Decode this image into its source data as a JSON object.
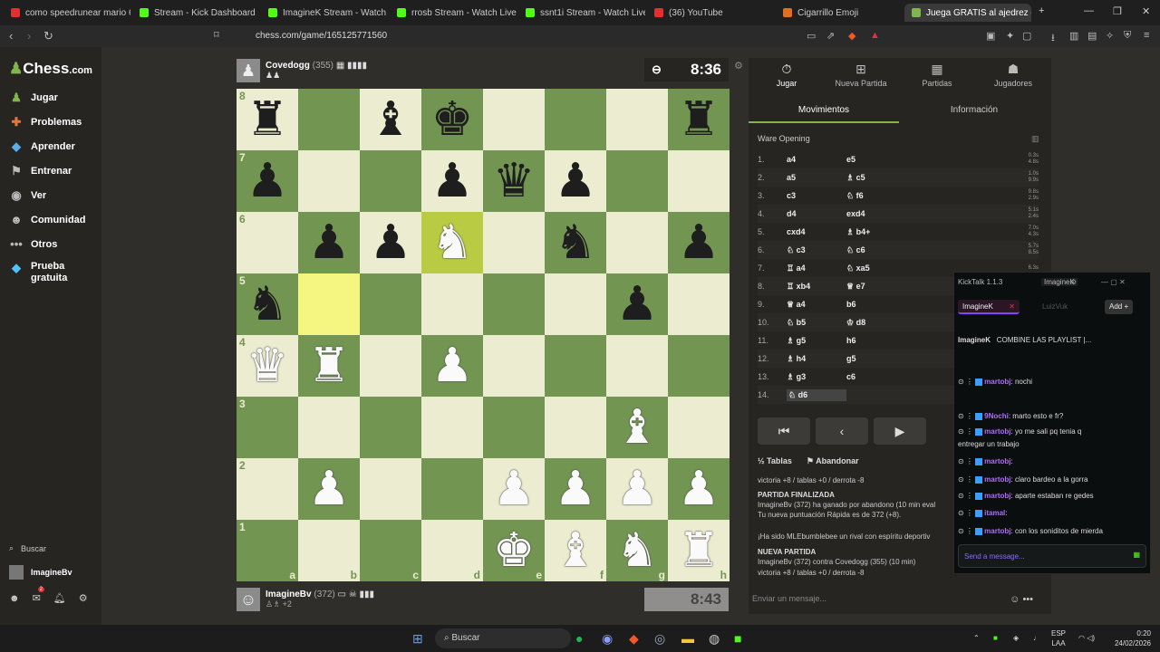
{
  "browser": {
    "tabs": [
      {
        "label": "como speedrunear mario 64 1(",
        "color": "#e03030"
      },
      {
        "label": "Stream - Kick Dashboard",
        "color": "#53fc18"
      },
      {
        "label": "ImagineK Stream - Watch Li",
        "color": "#53fc18"
      },
      {
        "label": "rrosb Stream - Watch Live",
        "color": "#53fc18"
      },
      {
        "label": "ssnt1i Stream - Watch Live",
        "color": "#53fc18"
      },
      {
        "label": "(36) YouTube",
        "color": "#e03030"
      },
      {
        "label": "Cigarrillo Emoji",
        "color": "#e07020"
      },
      {
        "label": "Juega GRATIS al ajedrez o",
        "color": "#81b64c"
      }
    ],
    "url": "chess.com/game/165125771560"
  },
  "sidebar": {
    "logo": "Chess",
    "logo_suffix": ".com",
    "items": [
      {
        "label": "Jugar",
        "icon": "play-icon",
        "color": "#81b64c"
      },
      {
        "label": "Problemas",
        "icon": "puzzle-icon",
        "color": "#e9773c"
      },
      {
        "label": "Aprender",
        "icon": "learn-icon",
        "color": "#5aaee8"
      },
      {
        "label": "Entrenar",
        "icon": "train-icon",
        "color": "#bbbbbb"
      },
      {
        "label": "Ver",
        "icon": "watch-icon",
        "color": "#bbbbbb"
      },
      {
        "label": "Comunidad",
        "icon": "community-icon",
        "color": "#bbbbbb"
      },
      {
        "label": "Otros",
        "icon": "more-icon",
        "color": "#bbbbbb"
      },
      {
        "label": "Prueba gratuita",
        "icon": "diamond-icon",
        "color": "#4fc3f7"
      }
    ],
    "search": "Buscar",
    "user": "ImagineBv",
    "notif_count": "2"
  },
  "game": {
    "top_player": {
      "name": "Covedogg",
      "rating": "(355)",
      "clock": "8:36"
    },
    "bottom_player": {
      "name": "ImagineBv",
      "rating": "(372)",
      "clock": "8:43",
      "material": "+2"
    },
    "board": [
      [
        "bR",
        "",
        "bB",
        "bK",
        "",
        "",
        "",
        "bR"
      ],
      [
        "bP",
        "",
        "",
        "bP",
        "bQ",
        "bP",
        "",
        ""
      ],
      [
        "",
        "bP",
        "bP",
        "wN",
        "",
        "bN",
        "",
        "bP"
      ],
      [
        "bN",
        "",
        "",
        "",
        "",
        "",
        "bP",
        ""
      ],
      [
        "wQ",
        "wR",
        "",
        "wP",
        "",
        "",
        "",
        ""
      ],
      [
        "",
        "",
        "",
        "",
        "",
        "",
        "wB",
        ""
      ],
      [
        "",
        "wP",
        "",
        "",
        "wP",
        "wP",
        "wP",
        "wP"
      ],
      [
        "",
        "",
        "",
        "",
        "wK",
        "wB",
        "wN",
        "wR"
      ]
    ],
    "highlights": [
      [
        2,
        3
      ],
      [
        3,
        1
      ]
    ],
    "files": [
      "a",
      "b",
      "c",
      "d",
      "e",
      "f",
      "g",
      "h"
    ],
    "ranks": [
      "8",
      "7",
      "6",
      "5",
      "4",
      "3",
      "2",
      "1"
    ]
  },
  "panel": {
    "tabs": [
      {
        "label": "Jugar",
        "icon": "stopwatch-icon"
      },
      {
        "label": "Nueva Partida",
        "icon": "plus-icon"
      },
      {
        "label": "Partidas",
        "icon": "board-icon"
      },
      {
        "label": "Jugadores",
        "icon": "players-icon"
      }
    ],
    "subtabs": [
      "Movimientos",
      "Información"
    ],
    "opening": "Ware Opening",
    "moves": [
      {
        "n": "1.",
        "w": "a4",
        "b": "e5",
        "t1": "0.3s",
        "t2": "4.8s"
      },
      {
        "n": "2.",
        "w": "a5",
        "b": "♗ c5",
        "t1": "1.0s",
        "t2": "9.9s"
      },
      {
        "n": "3.",
        "w": "c3",
        "b": "♘ f6",
        "t1": "9.8s",
        "t2": "2.9s"
      },
      {
        "n": "4.",
        "w": "d4",
        "b": "exd4",
        "t1": "5.1s",
        "t2": "2.4s"
      },
      {
        "n": "5.",
        "w": "cxd4",
        "b": "♗ b4+",
        "t1": "7.0s",
        "t2": "4.3s"
      },
      {
        "n": "6.",
        "w": "♘ c3",
        "b": "♘ c6",
        "t1": "5.7s",
        "t2": "8.5s"
      },
      {
        "n": "7.",
        "w": "♖ a4",
        "b": "♘ xa5",
        "t1": "6.3s",
        "t2": ""
      },
      {
        "n": "8.",
        "w": "♖ xb4",
        "b": "♕ e7",
        "t1": "",
        "t2": ""
      },
      {
        "n": "9.",
        "w": "♕ a4",
        "b": "b6",
        "t1": "",
        "t2": ""
      },
      {
        "n": "10.",
        "w": "♘ b5",
        "b": "♔ d8",
        "t1": "",
        "t2": ""
      },
      {
        "n": "11.",
        "w": "♗ g5",
        "b": "h6",
        "t1": "",
        "t2": ""
      },
      {
        "n": "12.",
        "w": "♗ h4",
        "b": "g5",
        "t1": "",
        "t2": ""
      },
      {
        "n": "13.",
        "w": "♗ g3",
        "b": "c6",
        "t1": "",
        "t2": ""
      },
      {
        "n": "14.",
        "w": "♘ d6",
        "b": "",
        "t1": "",
        "t2": ""
      }
    ],
    "draw": "Tablas",
    "resign": "Abandonar",
    "log": [
      {
        "text": "victoria +8 / tablas +0 / derrota -8",
        "h": false
      },
      {
        "text": "PARTIDA FINALIZADA",
        "h": true
      },
      {
        "text": "ImagineBv (372) ha ganado por abandono (10 min eval",
        "h": false
      },
      {
        "text": "Tu nueva puntuación Rápida es de 372 (+8).",
        "h": false
      },
      {
        "text": "¡Ha sido MLEbumblebee un rival con espíritu deportiv",
        "h": false
      },
      {
        "text": "NUEVA PARTIDA",
        "h": true
      },
      {
        "text": "ImagineBv (372) contra Covedogg (355) (10 min)",
        "h": false
      },
      {
        "text": "victoria +8 / tablas +0 / derrota -8",
        "h": false
      }
    ],
    "send_placeholder": "Enviar un mensaje..."
  },
  "kicktalk": {
    "title": "KickTalk 1.1.3",
    "header_user": "ImagineK",
    "tabs": [
      "ImagineK",
      "LuizVuk"
    ],
    "add": "Add",
    "channel": "ImagineK",
    "pinned": "COMBINE LAS PLAYLIST |...",
    "messages": [
      {
        "user": "martobj",
        "text": "nochi"
      },
      {
        "user": "9Nochi",
        "text": "marto esto e fr?"
      },
      {
        "user": "martobj",
        "text": "yo me sali pq tenia q"
      },
      {
        "user": "",
        "text": "entregar un trabajo"
      },
      {
        "user": "martobj",
        "text": ""
      },
      {
        "user": "martobj",
        "text": "claro bardeo a la gorra"
      },
      {
        "user": "martobj",
        "text": "aparte estaban re gedes"
      },
      {
        "user": "itamal",
        "text": ""
      },
      {
        "user": "martobj",
        "text": "con los soniditos de mierda"
      }
    ],
    "input_placeholder": "Send a message..."
  },
  "taskbar": {
    "search": "Buscar",
    "lang": "ESP",
    "lang2": "LAA",
    "time": "0:20",
    "date": "24/02/2026"
  }
}
